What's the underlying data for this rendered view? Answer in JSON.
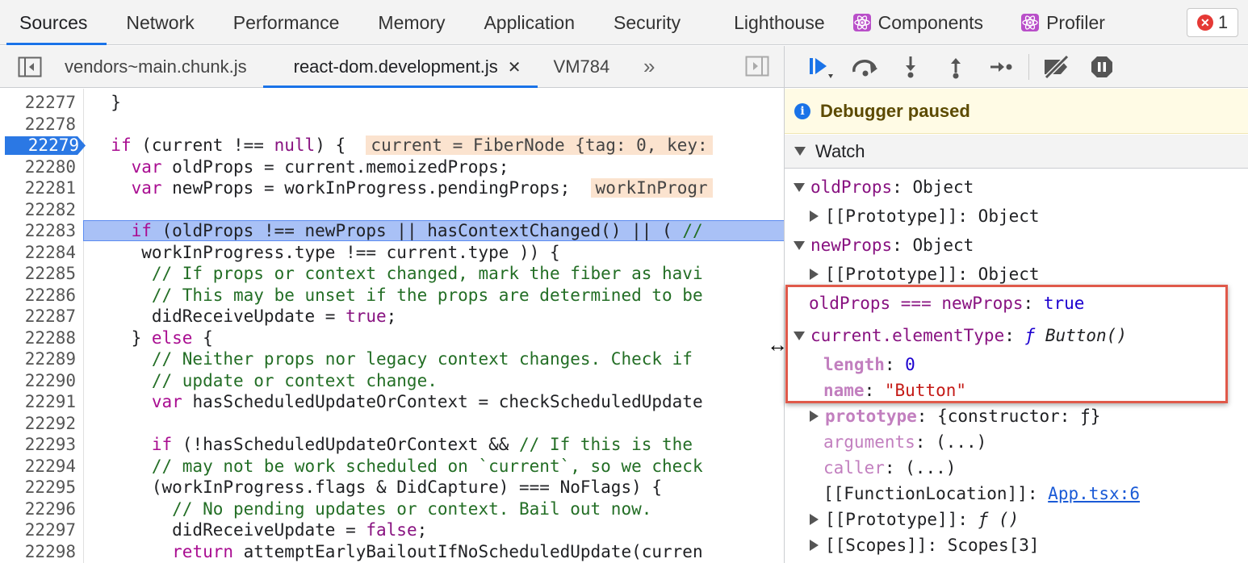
{
  "top_tabs": [
    {
      "label": "Sources",
      "active": true
    },
    {
      "label": "Network"
    },
    {
      "label": "Performance"
    },
    {
      "label": "Memory"
    },
    {
      "label": "Application"
    },
    {
      "label": "Security"
    },
    {
      "label": "Lighthouse"
    },
    {
      "label": "Components",
      "icon": "react-icon"
    },
    {
      "label": "Profiler",
      "icon": "react-icon"
    }
  ],
  "error_count": "1",
  "file_tabs": [
    {
      "label": "vendors~main.chunk.js"
    },
    {
      "label": "react-dom.development.js",
      "active": true,
      "closable": true
    },
    {
      "label": "VM784"
    }
  ],
  "more_tabs": "»",
  "code": {
    "breakpoint_line": "22279",
    "highlight_line": "22283",
    "lines": [
      {
        "n": "22277",
        "text": "  }"
      },
      {
        "n": "22278",
        "text": ""
      },
      {
        "n": "22279",
        "text": "  if (current !== null) {",
        "inline": "current = FiberNode {tag: 0, key:"
      },
      {
        "n": "22280",
        "text": "    var oldProps = current.memoizedProps;"
      },
      {
        "n": "22281",
        "text": "    var newProps = workInProgress.pendingProps;",
        "inline": "workInProgr"
      },
      {
        "n": "22282",
        "text": ""
      },
      {
        "n": "22283",
        "text": "    if (oldProps !== newProps || hasContextChanged() || ( //"
      },
      {
        "n": "22284",
        "text": "     workInProgress.type !== current.type )) {"
      },
      {
        "n": "22285",
        "text": "      // If props or context changed, mark the fiber as havi"
      },
      {
        "n": "22286",
        "text": "      // This may be unset if the props are determined to be"
      },
      {
        "n": "22287",
        "text": "      didReceiveUpdate = true;"
      },
      {
        "n": "22288",
        "text": "    } else {"
      },
      {
        "n": "22289",
        "text": "      // Neither props nor legacy context changes. Check if"
      },
      {
        "n": "22290",
        "text": "      // update or context change."
      },
      {
        "n": "22291",
        "text": "      var hasScheduledUpdateOrContext = checkScheduledUpdate"
      },
      {
        "n": "22292",
        "text": ""
      },
      {
        "n": "22293",
        "text": "      if (!hasScheduledUpdateOrContext && // If this is the"
      },
      {
        "n": "22294",
        "text": "      // may not be work scheduled on `current`, so we check"
      },
      {
        "n": "22295",
        "text": "      (workInProgress.flags & DidCapture) === NoFlags) {"
      },
      {
        "n": "22296",
        "text": "        // No pending updates or context. Bail out now."
      },
      {
        "n": "22297",
        "text": "        didReceiveUpdate = false;"
      },
      {
        "n": "22298",
        "text": "        return attemptEarlyBailoutIfNoScheduledUpdate(curren"
      }
    ]
  },
  "debugger": {
    "paused_text": "Debugger paused",
    "watch_label": "Watch"
  },
  "watch": {
    "oldProps_key": "oldProps",
    "oldProps_val": "Object",
    "proto1_key": "[[Prototype]]",
    "proto1_val": "Object",
    "newProps_key": "newProps",
    "newProps_val": "Object",
    "proto2_key": "[[Prototype]]",
    "proto2_val": "Object",
    "eq_key": "oldProps === newProps",
    "eq_val": "true",
    "et_key": "current.elementType",
    "et_f": "ƒ",
    "et_val": "Button()",
    "length_key": "length",
    "length_val": "0",
    "name_key": "name",
    "name_val": "\"Button\"",
    "prototype_key": "prototype",
    "prototype_val": "{constructor: ƒ}",
    "arguments_key": "arguments",
    "arguments_val": "(...)",
    "caller_key": "caller",
    "caller_val": "(...)",
    "fnloc_key": "[[FunctionLocation]]",
    "fnloc_val": "App.tsx:6",
    "proto3_key": "[[Prototype]]",
    "proto3_val": "ƒ ()",
    "scopes_key": "[[Scopes]]",
    "scopes_val": "Scopes[3]"
  },
  "colors": {
    "accent": "#1a73e8",
    "breakpoint": "#2b78e4",
    "highlight": "#a9c1f6",
    "annotation_box": "#e0594a"
  }
}
